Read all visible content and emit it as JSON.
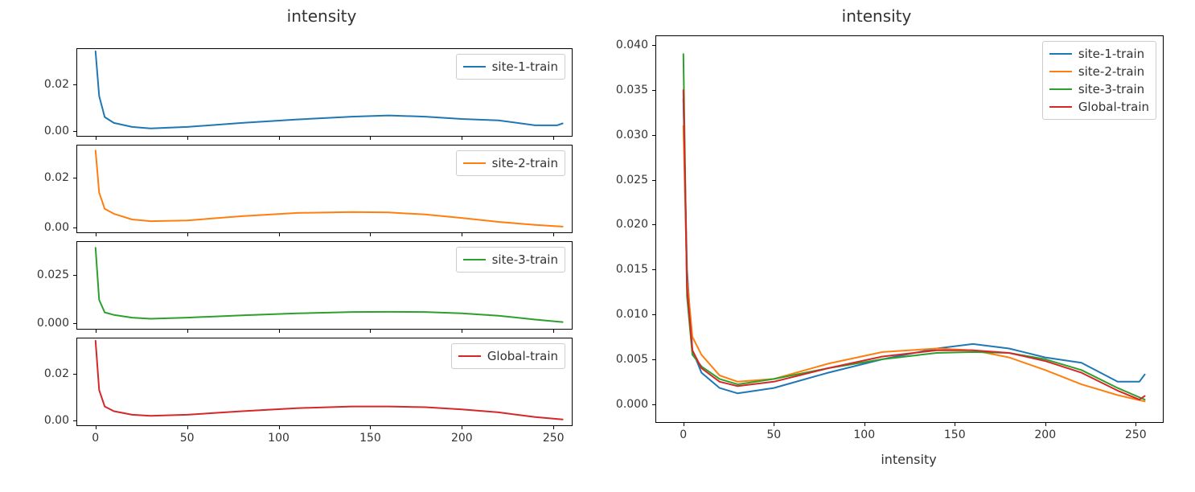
{
  "titles": {
    "left": "intensity",
    "right": "intensity"
  },
  "xlabel_right": "intensity",
  "colors": {
    "site1": "#1f77b4",
    "site2": "#ff7f0e",
    "site3": "#2ca02c",
    "global": "#d62728"
  },
  "legend_left": {
    "site1": "site-1-train",
    "site2": "site-2-train",
    "site3": "site-3-train",
    "global": "Global-train"
  },
  "legend_right": {
    "site1": "site-1-train",
    "site2": "site-2-train",
    "site3": "site-3-train",
    "global": "Global-train"
  },
  "chart_data": [
    {
      "type": "line",
      "title": "intensity",
      "subplot": "left-1-site-1-train",
      "xlabel": "",
      "ylabel": "",
      "xlim": [
        -10,
        260
      ],
      "ylim": [
        -0.002,
        0.035
      ],
      "yticks": [
        0.0,
        0.02
      ],
      "xticks": [
        0,
        50,
        100,
        150,
        200,
        250
      ],
      "series": [
        {
          "name": "site-1-train",
          "color": "#1f77b4",
          "x": [
            0,
            2,
            5,
            10,
            20,
            30,
            50,
            80,
            110,
            140,
            160,
            180,
            200,
            220,
            240,
            252,
            255
          ],
          "values": [
            0.034,
            0.015,
            0.006,
            0.0035,
            0.0018,
            0.0012,
            0.0018,
            0.0035,
            0.005,
            0.0062,
            0.0067,
            0.0062,
            0.0052,
            0.0046,
            0.0025,
            0.0025,
            0.0033
          ]
        }
      ]
    },
    {
      "type": "line",
      "subplot": "left-2-site-2-train",
      "xlim": [
        -10,
        260
      ],
      "ylim": [
        -0.002,
        0.033
      ],
      "yticks": [
        0.0,
        0.02
      ],
      "xticks": [
        0,
        50,
        100,
        150,
        200,
        250
      ],
      "series": [
        {
          "name": "site-2-train",
          "color": "#ff7f0e",
          "x": [
            0,
            2,
            5,
            10,
            20,
            30,
            50,
            80,
            110,
            140,
            160,
            180,
            200,
            220,
            240,
            255
          ],
          "values": [
            0.031,
            0.014,
            0.0075,
            0.0055,
            0.0032,
            0.0025,
            0.0028,
            0.0045,
            0.0058,
            0.0062,
            0.006,
            0.0052,
            0.0038,
            0.0022,
            0.001,
            0.0003
          ]
        }
      ]
    },
    {
      "type": "line",
      "subplot": "left-3-site-3-train",
      "xlim": [
        -10,
        260
      ],
      "ylim": [
        -0.003,
        0.042
      ],
      "yticks": [
        0.0,
        0.025
      ],
      "xticks": [
        0,
        50,
        100,
        150,
        200,
        250
      ],
      "series": [
        {
          "name": "site-3-train",
          "color": "#2ca02c",
          "x": [
            0,
            2,
            5,
            10,
            20,
            30,
            50,
            80,
            110,
            140,
            160,
            180,
            200,
            220,
            240,
            255
          ],
          "values": [
            0.039,
            0.012,
            0.0055,
            0.0042,
            0.0028,
            0.0022,
            0.0028,
            0.004,
            0.005,
            0.0057,
            0.0058,
            0.0057,
            0.005,
            0.0038,
            0.0018,
            0.0005
          ]
        }
      ]
    },
    {
      "type": "line",
      "subplot": "left-4-global-train",
      "xlim": [
        -10,
        260
      ],
      "ylim": [
        -0.002,
        0.035
      ],
      "yticks": [
        0.0,
        0.02
      ],
      "xticks": [
        0,
        50,
        100,
        150,
        200,
        250
      ],
      "series": [
        {
          "name": "Global-train",
          "color": "#d62728",
          "x": [
            0,
            2,
            5,
            10,
            20,
            30,
            50,
            80,
            110,
            140,
            160,
            180,
            200,
            220,
            240,
            255
          ],
          "values": [
            0.034,
            0.013,
            0.006,
            0.004,
            0.0025,
            0.002,
            0.0025,
            0.004,
            0.0053,
            0.006,
            0.006,
            0.0057,
            0.0048,
            0.0035,
            0.0015,
            0.0005
          ]
        }
      ]
    },
    {
      "type": "line",
      "subplot": "right-overlay",
      "title": "intensity",
      "xlabel": "intensity",
      "ylabel": "",
      "xlim": [
        -15,
        265
      ],
      "ylim": [
        -0.002,
        0.041
      ],
      "yticks": [
        0.0,
        0.005,
        0.01,
        0.015,
        0.02,
        0.025,
        0.03,
        0.035,
        0.04
      ],
      "xticks": [
        0,
        50,
        100,
        150,
        200,
        250
      ],
      "series": [
        {
          "name": "site-1-train",
          "color": "#1f77b4",
          "x": [
            0,
            2,
            5,
            10,
            20,
            30,
            50,
            80,
            110,
            140,
            160,
            180,
            200,
            220,
            240,
            252,
            255
          ],
          "values": [
            0.034,
            0.015,
            0.006,
            0.0035,
            0.0018,
            0.0012,
            0.0018,
            0.0035,
            0.005,
            0.0062,
            0.0067,
            0.0062,
            0.0052,
            0.0046,
            0.0025,
            0.0025,
            0.0033
          ]
        },
        {
          "name": "site-2-train",
          "color": "#ff7f0e",
          "x": [
            0,
            2,
            5,
            10,
            20,
            30,
            50,
            80,
            110,
            140,
            160,
            180,
            200,
            220,
            240,
            255
          ],
          "values": [
            0.031,
            0.014,
            0.0075,
            0.0055,
            0.0032,
            0.0025,
            0.0028,
            0.0045,
            0.0058,
            0.0062,
            0.006,
            0.0052,
            0.0038,
            0.0022,
            0.001,
            0.0003
          ]
        },
        {
          "name": "site-3-train",
          "color": "#2ca02c",
          "x": [
            0,
            2,
            5,
            10,
            20,
            30,
            50,
            80,
            110,
            140,
            160,
            180,
            200,
            220,
            240,
            255
          ],
          "values": [
            0.039,
            0.012,
            0.0055,
            0.0042,
            0.0028,
            0.0022,
            0.0028,
            0.004,
            0.005,
            0.0057,
            0.0058,
            0.0057,
            0.005,
            0.0038,
            0.0018,
            0.0005
          ]
        },
        {
          "name": "Global-train",
          "color": "#d62728",
          "x": [
            0,
            2,
            5,
            10,
            20,
            30,
            50,
            80,
            110,
            140,
            160,
            180,
            200,
            220,
            240,
            252,
            255
          ],
          "values": [
            0.035,
            0.013,
            0.006,
            0.004,
            0.0025,
            0.002,
            0.0025,
            0.004,
            0.0053,
            0.006,
            0.006,
            0.0057,
            0.0048,
            0.0035,
            0.0015,
            0.0005,
            0.0009
          ]
        }
      ]
    }
  ],
  "ytick_labels": {
    "left1": [
      "0.00",
      "0.02"
    ],
    "left2": [
      "0.00",
      "0.02"
    ],
    "left3": [
      "0.000",
      "0.025"
    ],
    "left4": [
      "0.00",
      "0.02"
    ],
    "right": [
      "0.000",
      "0.005",
      "0.010",
      "0.015",
      "0.020",
      "0.025",
      "0.030",
      "0.035",
      "0.040"
    ]
  },
  "xtick_labels": {
    "left": [
      "0",
      "50",
      "100",
      "150",
      "200",
      "250"
    ],
    "right": [
      "0",
      "50",
      "100",
      "150",
      "200",
      "250"
    ]
  }
}
